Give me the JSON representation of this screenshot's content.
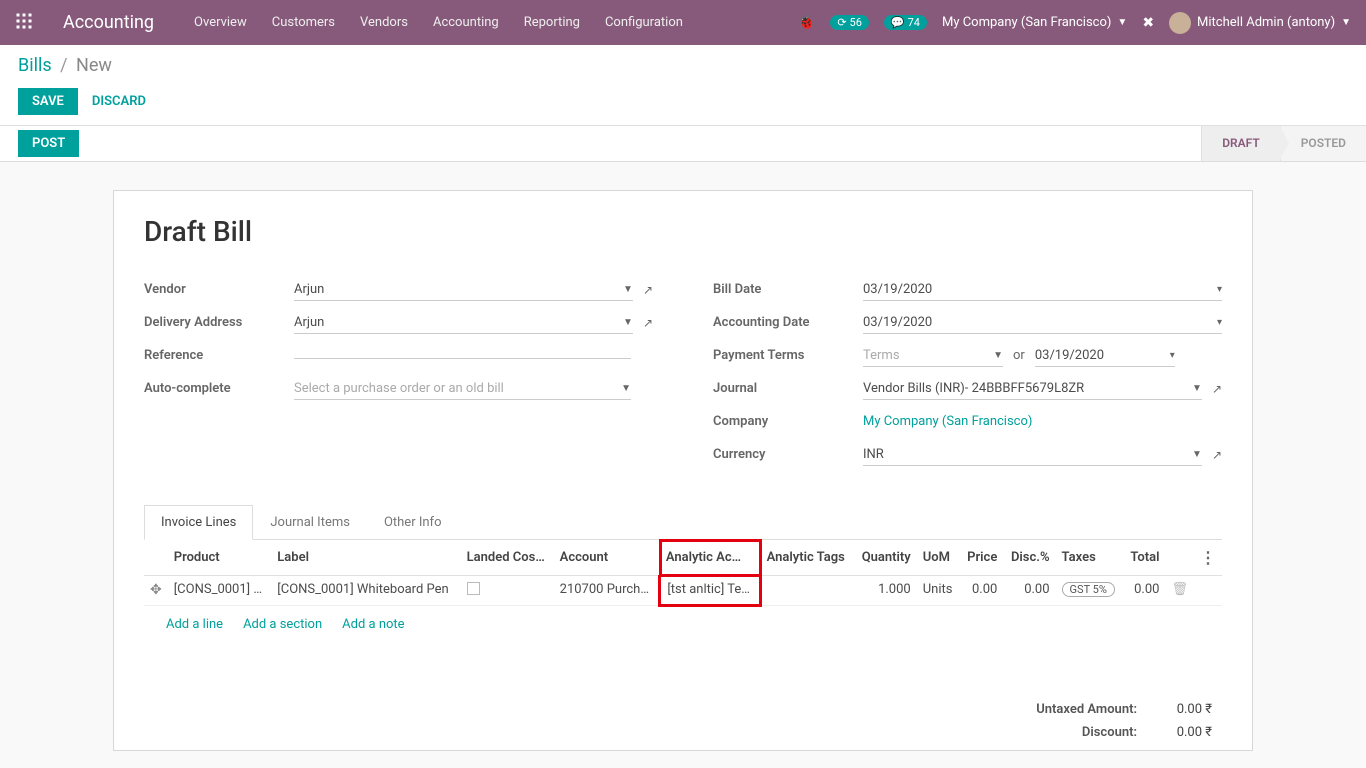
{
  "app": "Accounting",
  "nav": [
    "Overview",
    "Customers",
    "Vendors",
    "Accounting",
    "Reporting",
    "Configuration"
  ],
  "topbar": {
    "msg_count": "56",
    "chat_count": "74",
    "company": "My Company (San Francisco)",
    "user": "Mitchell Admin (antony)"
  },
  "breadcrumb": {
    "root": "Bills",
    "current": "New"
  },
  "buttons": {
    "save": "SAVE",
    "discard": "DISCARD",
    "post": "POST"
  },
  "status": {
    "draft": "DRAFT",
    "posted": "POSTED"
  },
  "form": {
    "title": "Draft Bill",
    "labels": {
      "vendor": "Vendor",
      "delivery": "Delivery Address",
      "reference": "Reference",
      "autocomplete": "Auto-complete",
      "bill_date": "Bill Date",
      "accounting_date": "Accounting Date",
      "payment_terms": "Payment Terms",
      "journal": "Journal",
      "company": "Company",
      "currency": "Currency"
    },
    "values": {
      "vendor": "Arjun",
      "delivery": "Arjun",
      "reference": "",
      "autocomplete_placeholder": "Select a purchase order or an old bill",
      "bill_date": "03/19/2020",
      "accounting_date": "03/19/2020",
      "terms_placeholder": "Terms",
      "or": "or",
      "due_date": "03/19/2020",
      "journal": "Vendor Bills (INR)- 24BBBFF5679L8ZR",
      "company": "My Company (San Francisco)",
      "currency": "INR"
    }
  },
  "tabs": [
    "Invoice Lines",
    "Journal Items",
    "Other Info"
  ],
  "table": {
    "headers": {
      "product": "Product",
      "label": "Label",
      "landed": "Landed Cos…",
      "account": "Account",
      "analytic_acc": "Analytic Ac…",
      "analytic_tags": "Analytic Tags",
      "quantity": "Quantity",
      "uom": "UoM",
      "price": "Price",
      "disc": "Disc.%",
      "taxes": "Taxes",
      "total": "Total"
    },
    "row": {
      "product": "[CONS_0001] …",
      "label": "[CONS_0001] Whiteboard Pen",
      "account": "210700 Purch…",
      "analytic": "[tst anltic] Te…",
      "quantity": "1.000",
      "uom": "Units",
      "price": "0.00",
      "disc": "0.00",
      "tax": "GST 5%",
      "total": "0.00"
    },
    "add": {
      "line": "Add a line",
      "section": "Add a section",
      "note": "Add a note"
    }
  },
  "totals": {
    "untaxed_label": "Untaxed Amount:",
    "untaxed_val": "0.00 ₹",
    "discount_label": "Discount:",
    "discount_val": "0.00 ₹"
  }
}
